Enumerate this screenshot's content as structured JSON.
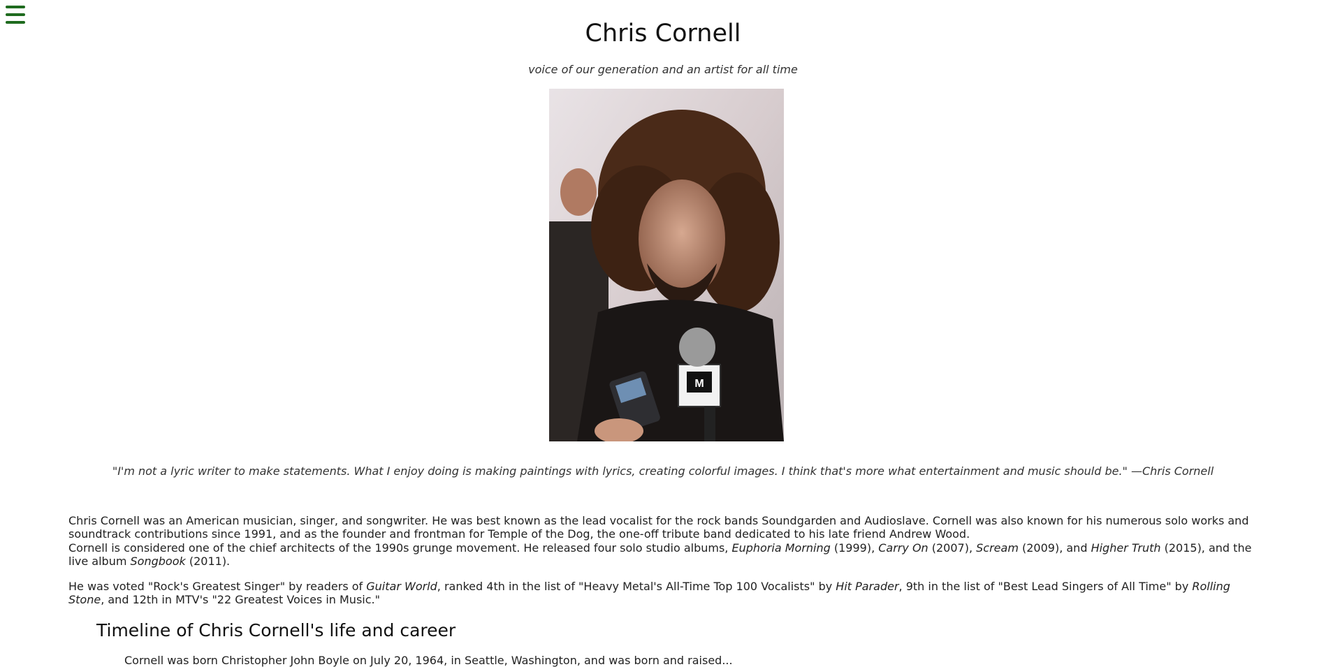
{
  "menu": {
    "icon": "hamburger-menu-icon"
  },
  "header": {
    "title": "Chris Cornell",
    "tagline": "voice of our generation and an artist for all time"
  },
  "image": {
    "alt": "Chris Cornell being interviewed with an MTV microphone"
  },
  "quote": "\"I'm not a lyric writer to make statements. What I enjoy doing is making paintings with lyrics, creating colorful images. I think that's more what entertainment and music should be.\" —Chris Cornell",
  "bio": {
    "p1": "Chris Cornell was an American musician, singer, and songwriter. He was best known as the lead vocalist for the rock bands Soundgarden and Audioslave. Cornell was also known for his numerous solo works and soundtrack contributions since 1991, and as the founder and frontman for Temple of the Dog, the one-off tribute band dedicated to his late friend Andrew Wood.",
    "p2": {
      "t1": "Cornell is considered one of the chief architects of the 1990s grunge movement. He released four solo studio albums, ",
      "a1": "Euphoria Morning",
      "t2": " (1999), ",
      "a2": "Carry On",
      "t3": " (2007), ",
      "a3": "Scream",
      "t4": " (2009), and ",
      "a4": "Higher Truth",
      "t5": " (2015), and the live album ",
      "a5": "Songbook",
      "t6": " (2011)."
    },
    "p3": {
      "t1": "He was voted \"Rock's Greatest Singer\" by readers of ",
      "m1": "Guitar World",
      "t2": ", ranked 4th in the list of \"Heavy Metal's All-Time Top 100 Vocalists\" by ",
      "m2": "Hit Parader",
      "t3": ", 9th in the list of \"Best Lead Singers of All Time\" by ",
      "m3": "Rolling Stone",
      "t4": ", and 12th in MTV's \"22 Greatest Voices in Music.\""
    }
  },
  "timeline": {
    "heading": "Timeline of Chris Cornell's life and career",
    "first_item": "Cornell was born Christopher John Boyle on July 20, 1964, in Seattle, Washington, and was born and raised..."
  },
  "colors": {
    "menu": "#1f6b1f"
  }
}
